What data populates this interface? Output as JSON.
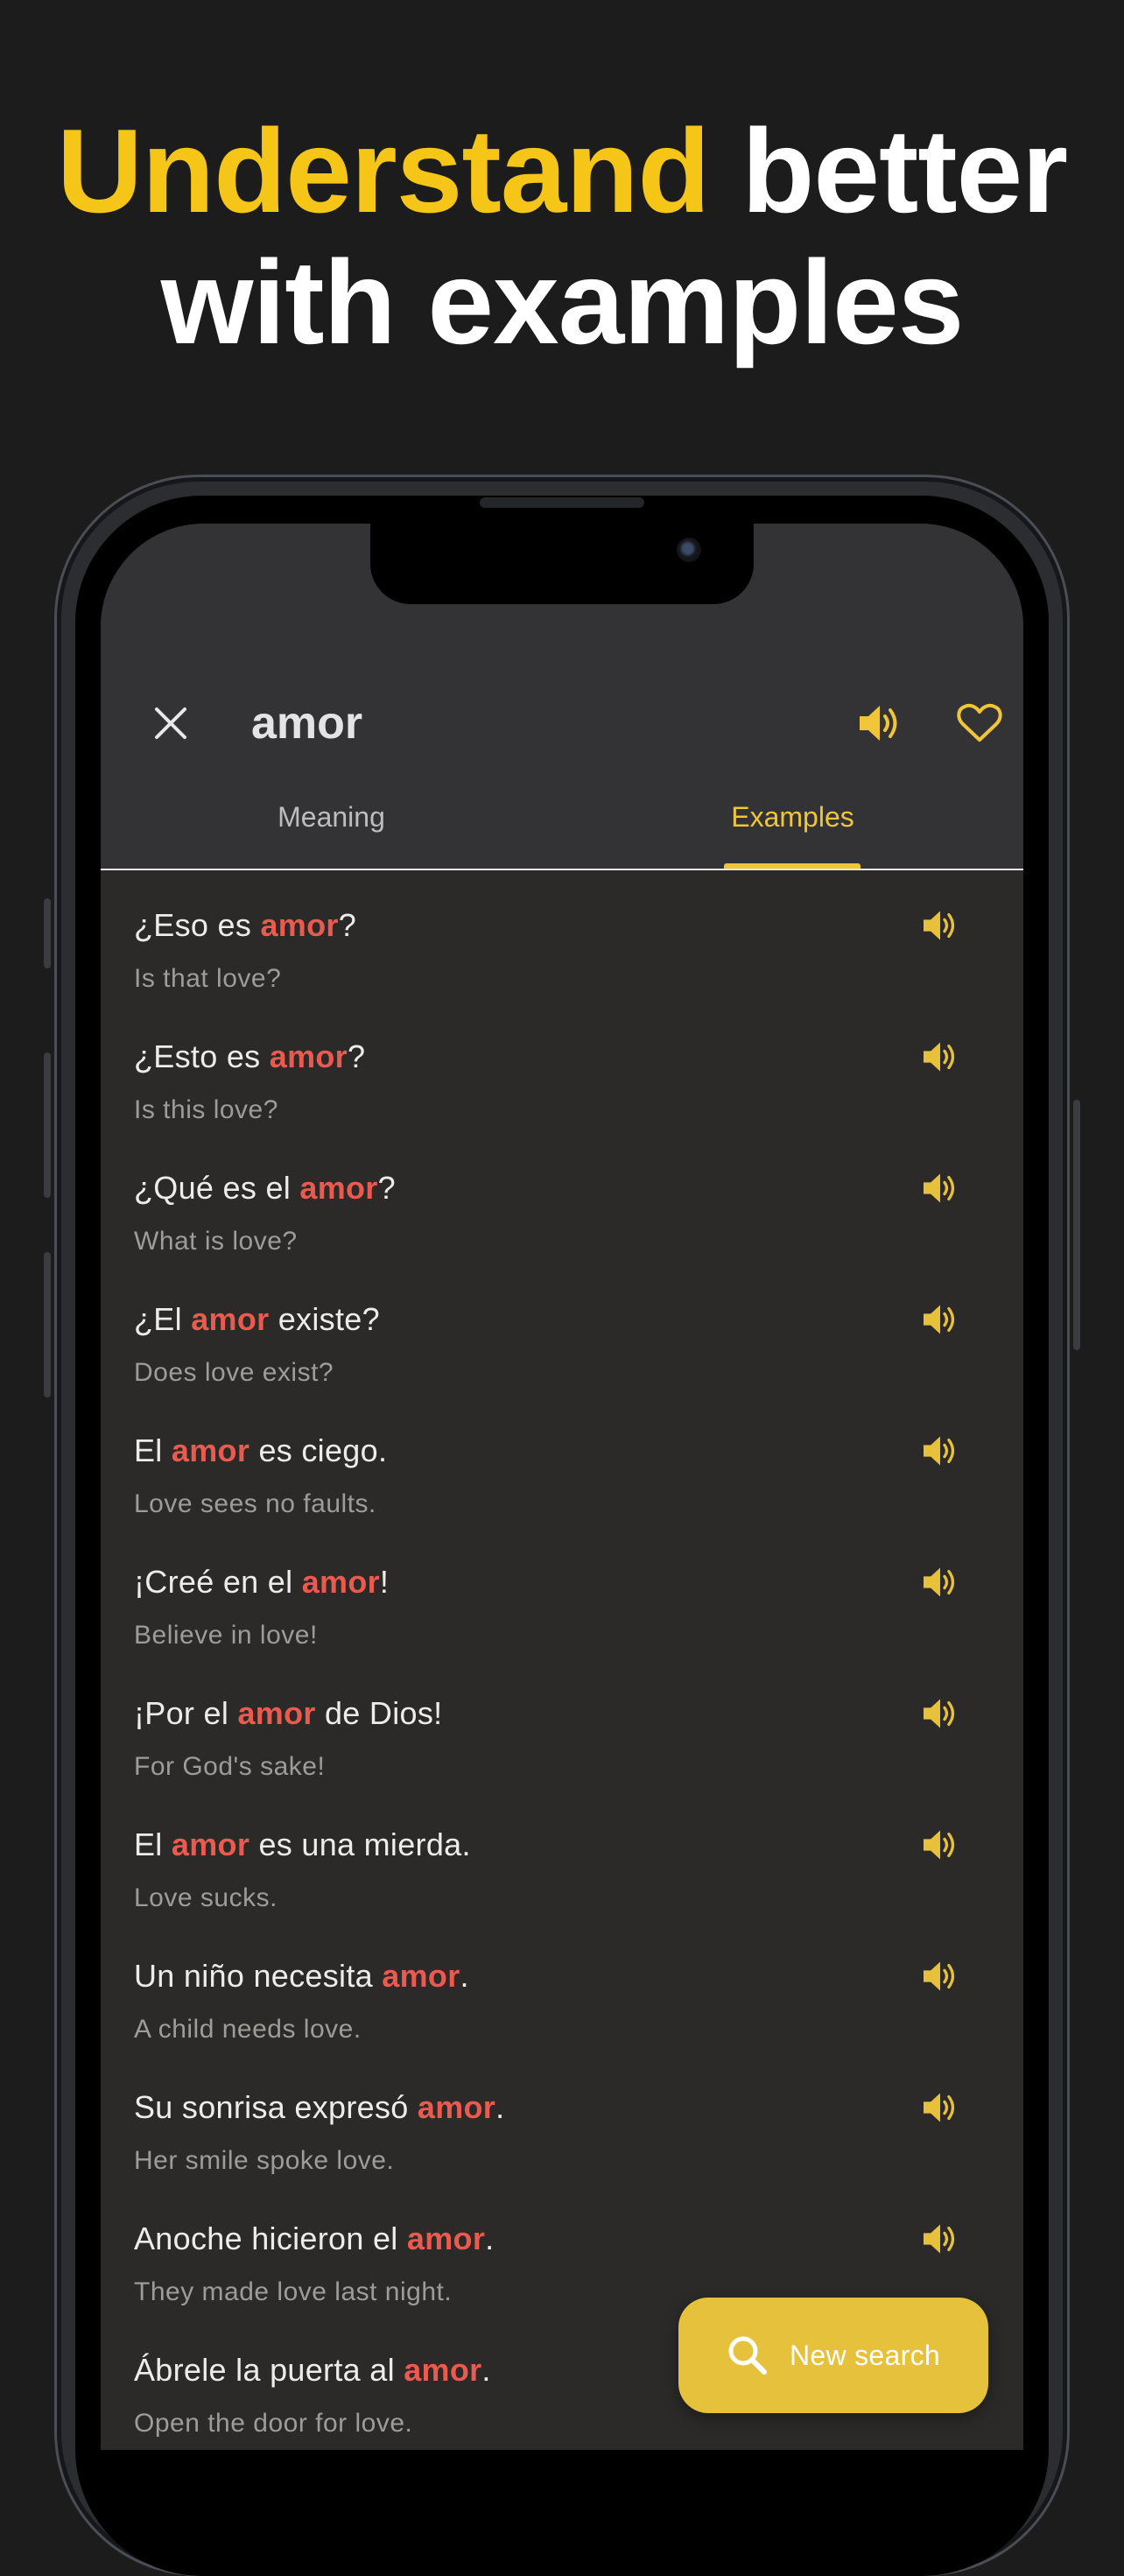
{
  "headline": {
    "accent": "Understand",
    "rest": " better",
    "line2": "with examples"
  },
  "header": {
    "word": "amor",
    "close_icon": "close-icon",
    "speaker_icon": "speaker-icon",
    "favorite_icon": "heart-icon"
  },
  "tabs": [
    {
      "label": "Meaning",
      "active": false
    },
    {
      "label": "Examples",
      "active": true
    }
  ],
  "examples": [
    {
      "pre": "¿Eso es ",
      "hl": "amor",
      "post": "?",
      "en": "Is that love?"
    },
    {
      "pre": "¿Esto es ",
      "hl": "amor",
      "post": "?",
      "en": "Is this love?"
    },
    {
      "pre": "¿Qué es el ",
      "hl": "amor",
      "post": "?",
      "en": "What is love?"
    },
    {
      "pre": "¿El ",
      "hl": "amor",
      "post": " existe?",
      "en": "Does love exist?"
    },
    {
      "pre": "El ",
      "hl": "amor",
      "post": " es ciego.",
      "en": "Love sees no faults."
    },
    {
      "pre": "¡Creé en el ",
      "hl": "amor",
      "post": "!",
      "en": "Believe in love!"
    },
    {
      "pre": "¡Por el ",
      "hl": "amor",
      "post": " de Dios!",
      "en": "For God's sake!"
    },
    {
      "pre": "El ",
      "hl": "amor",
      "post": " es una mierda.",
      "en": "Love sucks."
    },
    {
      "pre": "Un niño necesita ",
      "hl": "amor",
      "post": ".",
      "en": "A child needs love."
    },
    {
      "pre": "Su sonrisa expresó ",
      "hl": "amor",
      "post": ".",
      "en": "Her smile spoke love."
    },
    {
      "pre": "Anoche hicieron el ",
      "hl": "amor",
      "post": ".",
      "en": "They made love last night."
    },
    {
      "pre": "Ábrele la puerta al ",
      "hl": "amor",
      "post": ".",
      "en": "Open the door for love."
    }
  ],
  "new_search": {
    "label": "New search",
    "icon": "search-icon"
  },
  "colors": {
    "background": "#1c1c1c",
    "accent": "#f5c518",
    "highlight": "#ea5a4f",
    "button": "#e6c23c"
  }
}
